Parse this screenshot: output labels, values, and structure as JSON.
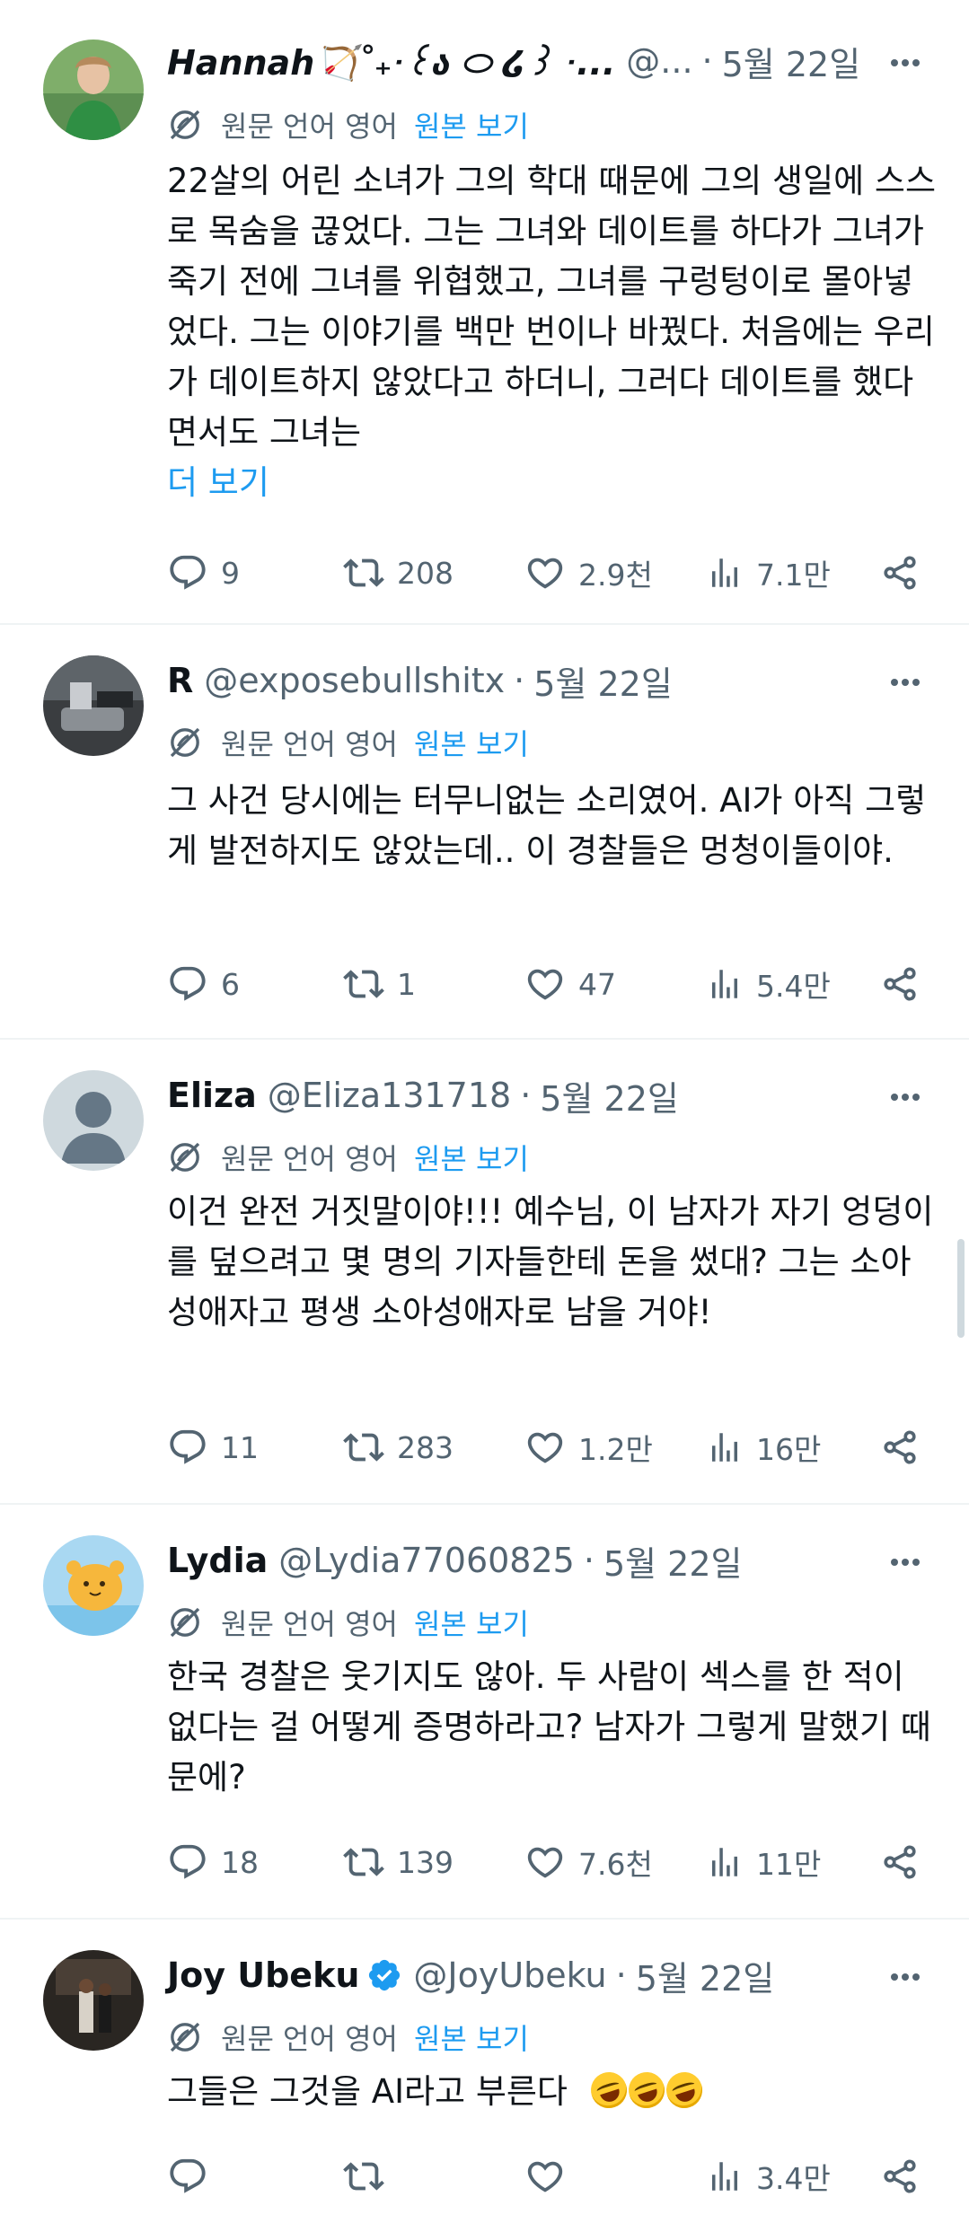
{
  "translate": {
    "label": "원문 언어 영어",
    "link": "원본 보기"
  },
  "tweets": [
    {
      "name": "Hannah🏹˚₊‧꒰ა ⬭ ໒꒱ ‧...",
      "handle": "@...",
      "date": "5월 22일",
      "text": "22살의 어린 소녀가 그의 학대 때문에 그의 생일에 스스로 목숨을 끊었다. 그는 그녀와 데이트를 하다가 그녀가 죽기 전에 그녀를 위협했고, 그녀를 구렁텅이로 몰아넣었다. 그는 이야기를 백만 번이나 바꿨다. 처음에는 우리가 데이트하지 않았다고 하더니, 그러다 데이트를 했다면서도 그녀는",
      "see_more": "더 보기",
      "replies": "9",
      "retweets": "208",
      "likes": "2.9천",
      "views": "7.1만"
    },
    {
      "name": "R",
      "handle": "@exposebullshitx",
      "date": "5월 22일",
      "text": "그 사건 당시에는 터무니없는 소리였어. AI가 아직 그렇게 발전하지도 않았는데.. 이 경찰들은 멍청이들이야.",
      "replies": "6",
      "retweets": "1",
      "likes": "47",
      "views": "5.4만"
    },
    {
      "name": "Eliza",
      "handle": "@Eliza131718",
      "date": "5월 22일",
      "text": "이건 완전 거짓말이야!!! 예수님, 이 남자가 자기 엉덩이를 덮으려고 몇 명의 기자들한테 돈을 썼대? 그는 소아성애자고 평생 소아성애자로 남을 거야!",
      "replies": "11",
      "retweets": "283",
      "likes": "1.2만",
      "views": "16만"
    },
    {
      "name": "Lydia",
      "handle": "@Lydia77060825",
      "date": "5월 22일",
      "text": "한국 경찰은 웃기지도 않아. 두 사람이 섹스를 한 적이 없다는 걸 어떻게 증명하라고? 남자가 그렇게 말했기 때문에?",
      "replies": "18",
      "retweets": "139",
      "likes": "7.6천",
      "views": "11만"
    },
    {
      "name": "Joy Ubeku",
      "handle": "@JoyUbeku",
      "date": "5월 22일",
      "text": "그들은 그것을 AI라고 부른다",
      "views": "3.4만"
    }
  ],
  "colors": {
    "accent": "#1d9bf0",
    "secondary_text": "#536471",
    "divider": "#eff3f4",
    "verified": "#1d9bf0"
  },
  "icons": [
    "reply-icon",
    "retweet-icon",
    "like-icon",
    "views-icon",
    "share-icon",
    "more-icon",
    "translate-icon",
    "verified-icon",
    "rolling-laughing-emoji"
  ]
}
